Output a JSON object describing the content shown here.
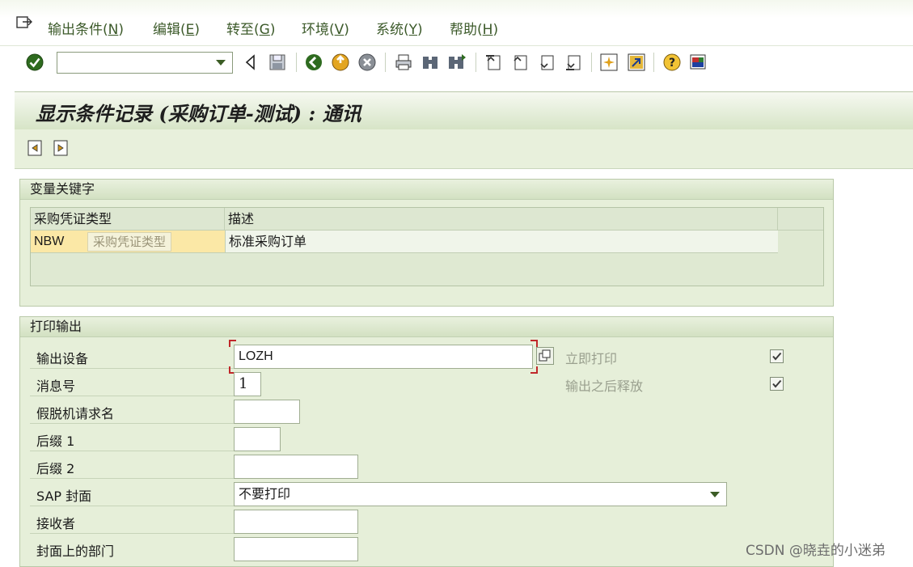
{
  "menu": {
    "items": [
      {
        "label": "输出条件(",
        "acc": "N",
        "end": ")"
      },
      {
        "label": "编辑(",
        "acc": "E",
        "end": ")"
      },
      {
        "label": "转至(",
        "acc": "G",
        "end": ")"
      },
      {
        "label": "环境(",
        "acc": "V",
        "end": ")"
      },
      {
        "label": "系统(",
        "acc": "Y",
        "end": ")"
      },
      {
        "label": "帮助(",
        "acc": "H",
        "end": ")"
      }
    ]
  },
  "toolbar": {
    "command_value": "",
    "icons": [
      "check-icon",
      "back-arrow-icon",
      "save-icon",
      "back-green-icon",
      "exit-icon",
      "cancel-icon",
      "print-icon",
      "find-icon",
      "find-next-icon",
      "first-page-icon",
      "prev-page-icon",
      "next-page-icon",
      "last-page-icon",
      "new-session-icon",
      "shortcut-icon",
      "help-icon",
      "layout-icon"
    ]
  },
  "title": "显示条件记录 (采购订单-测试) : 通讯",
  "group_variable_key": {
    "title": "变量关键字",
    "columns": [
      "采购凭证类型",
      "描述"
    ],
    "row": {
      "doc_type": "NBW",
      "description": "标准采购订单"
    },
    "tooltip": "采购凭证类型"
  },
  "group_print_output": {
    "title": "打印输出",
    "fields": {
      "output_device_label": "输出设备",
      "output_device_value": "LOZH",
      "message_no_label": "消息号",
      "message_no_value": "1",
      "spool_name_label": "假脱机请求名",
      "suffix1_label": "后缀 1",
      "suffix2_label": "后缀 2",
      "sap_cover_label": "SAP 封面",
      "sap_cover_value": "不要打印",
      "recipient_label": "接收者",
      "department_label": "封面上的部门"
    },
    "print_immediately_label": "立即打印",
    "release_after_output_label": "输出之后释放",
    "print_immediately_checked": true,
    "release_after_output_checked": true
  },
  "watermark": "CSDN @晓垚的小迷弟"
}
